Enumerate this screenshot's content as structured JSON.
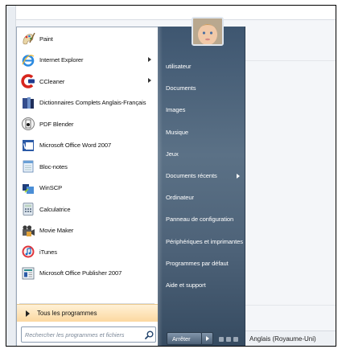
{
  "programs": [
    {
      "label": "Paint",
      "icon": "paint-icon",
      "submenu": false
    },
    {
      "label": "Internet Explorer",
      "icon": "internet-explorer-icon",
      "submenu": true
    },
    {
      "label": "CCleaner",
      "icon": "ccleaner-icon",
      "submenu": true
    },
    {
      "label": "Dictionnaires Complets Anglais-Français",
      "icon": "dictionary-icon",
      "submenu": false
    },
    {
      "label": "PDF Blender",
      "icon": "pdf-blender-icon",
      "submenu": false
    },
    {
      "label": "Microsoft Office Word 2007",
      "icon": "word-icon",
      "submenu": false
    },
    {
      "label": "Bloc-notes",
      "icon": "notepad-icon",
      "submenu": false
    },
    {
      "label": "WinSCP",
      "icon": "winscp-icon",
      "submenu": false
    },
    {
      "label": "Calculatrice",
      "icon": "calculator-icon",
      "submenu": false
    },
    {
      "label": "Movie Maker",
      "icon": "movie-maker-icon",
      "submenu": false
    },
    {
      "label": "iTunes",
      "icon": "itunes-icon",
      "submenu": false
    },
    {
      "label": "Microsoft Office Publisher 2007",
      "icon": "publisher-icon",
      "submenu": false
    }
  ],
  "all_programs_label": "Tous les programmes",
  "search": {
    "placeholder": "Rechercher les programmes et fichiers"
  },
  "right_menu": [
    {
      "label": "utilisateur",
      "submenu": false
    },
    {
      "label": "Documents",
      "submenu": false
    },
    {
      "label": "Images",
      "submenu": false
    },
    {
      "label": "Musique",
      "submenu": false
    },
    {
      "label": "Jeux",
      "submenu": false
    },
    {
      "label": "Documents récents",
      "submenu": true
    },
    {
      "label": "Ordinateur",
      "submenu": false
    },
    {
      "label": "Panneau de configuration",
      "submenu": false
    },
    {
      "label": "Périphériques et imprimantes",
      "submenu": false
    },
    {
      "label": "Programmes par défaut",
      "submenu": false
    },
    {
      "label": "Aide et support",
      "submenu": false
    }
  ],
  "shutdown_label": "Arrêter",
  "background": {
    "language": "Anglais (Royaume-Uni)"
  },
  "colors": {
    "all_programs_highlight": "#fcd8a0",
    "right_pane": "#4d6278"
  }
}
